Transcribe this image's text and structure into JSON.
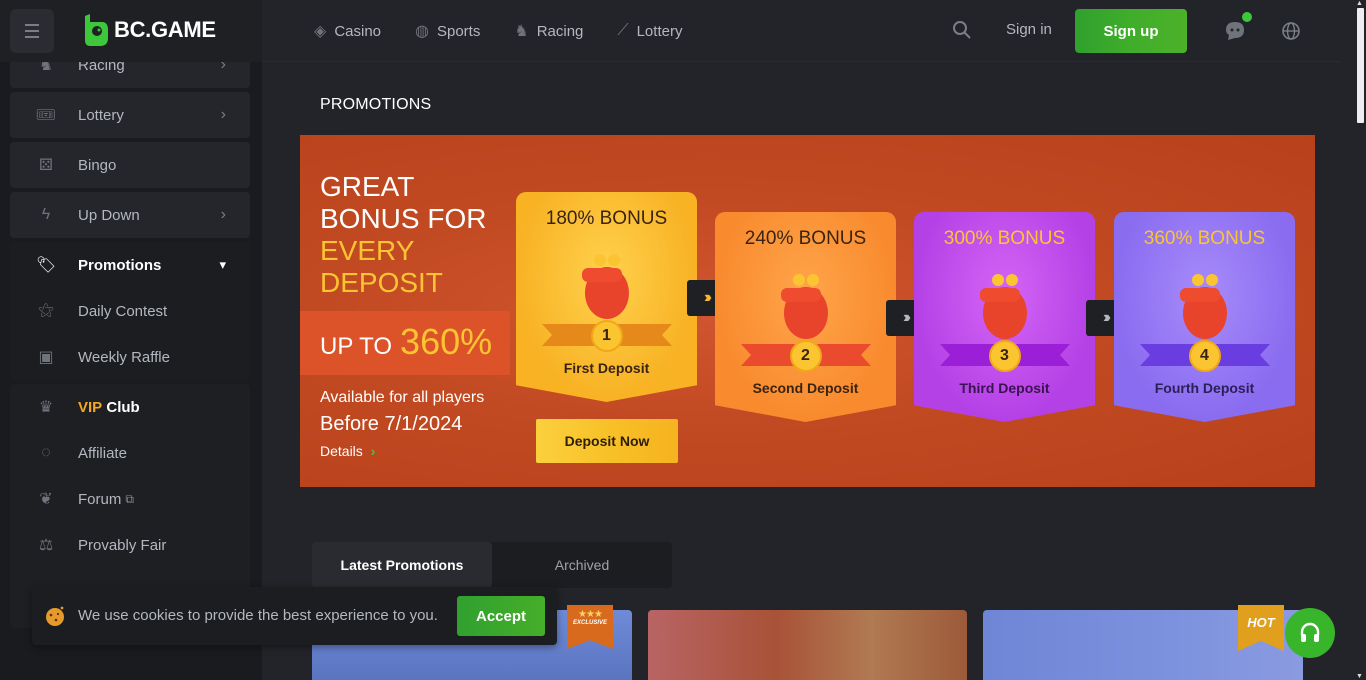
{
  "brand": {
    "name": "BC.GAME",
    "accent": "#3ec73a"
  },
  "header": {
    "nav": [
      {
        "label": "Casino",
        "icon": "casino-cards-icon"
      },
      {
        "label": "Sports",
        "icon": "basketball-icon"
      },
      {
        "label": "Racing",
        "icon": "horse-icon"
      },
      {
        "label": "Lottery",
        "icon": "ticket-icon"
      }
    ],
    "sign_in": "Sign in",
    "sign_up": "Sign up"
  },
  "sidebar": {
    "items": [
      {
        "label": "Racing",
        "icon": "horse-icon",
        "chevron": true
      },
      {
        "label": "Lottery",
        "icon": "ticket-icon",
        "chevron": true
      },
      {
        "label": "Bingo",
        "icon": "bingo-icon",
        "chevron": false
      },
      {
        "label": "Up Down",
        "icon": "lightning-icon",
        "chevron": true
      }
    ],
    "promotions": {
      "label": "Promotions",
      "children": [
        {
          "label": "Daily Contest"
        },
        {
          "label": "Weekly Raffle"
        }
      ]
    },
    "vip": {
      "prefix": "VIP",
      "suffix": "Club"
    },
    "more": [
      {
        "label": "Affiliate"
      },
      {
        "label": "Forum"
      },
      {
        "label": "Provably Fair"
      }
    ]
  },
  "main": {
    "title": "PROMOTIONS",
    "banner": {
      "line1": "GREAT",
      "line2": "BONUS FOR",
      "line3": "EVERY",
      "line4": "DEPOSIT",
      "up_to": "UP TO",
      "max_pct": "360%",
      "available": "Available for all players",
      "before": "Before 7/1/2024",
      "details": "Details",
      "cta": "Deposit Now",
      "cards": [
        {
          "title": "180% BONUS",
          "num": "1",
          "name": "First Deposit"
        },
        {
          "title": "240% BONUS",
          "num": "2",
          "name": "Second Deposit"
        },
        {
          "title": "300% BONUS",
          "num": "3",
          "name": "Third Deposit"
        },
        {
          "title": "360% BONUS",
          "num": "4",
          "name": "Fourth Deposit"
        }
      ]
    },
    "tabs": [
      {
        "label": "Latest Promotions",
        "active": true
      },
      {
        "label": "Archived",
        "active": false
      }
    ],
    "tags": {
      "exclusive": "EXCLUSIVE",
      "hot": "HOT"
    }
  },
  "cookie": {
    "text": "We use cookies to provide the best experience to you.",
    "accept": "Accept"
  }
}
